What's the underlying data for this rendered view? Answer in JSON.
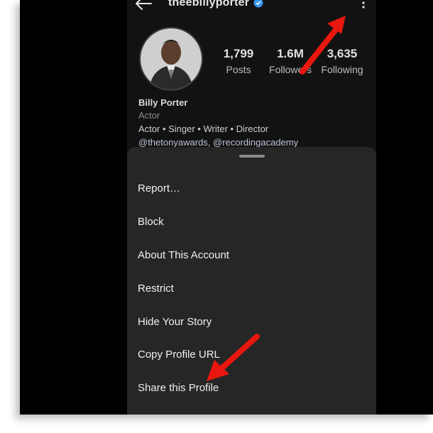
{
  "header": {
    "username": "theebillyporter",
    "icons": {
      "back": "arrow-left-icon",
      "verified": "verified-badge-icon",
      "more": "more-vertical-icon"
    }
  },
  "profile": {
    "stats": [
      {
        "value": "1,799",
        "label": "Posts"
      },
      {
        "value": "1.6M",
        "label": "Followers"
      },
      {
        "value": "3,635",
        "label": "Following"
      }
    ],
    "bio": {
      "name": "Billy Porter",
      "category": "Actor",
      "text": "Actor • Singer • Writer • Director",
      "mentions": "@thetonyawards, @recordingacademy"
    }
  },
  "menu": {
    "items": [
      {
        "label": "Report…"
      },
      {
        "label": "Block"
      },
      {
        "label": "About This Account"
      },
      {
        "label": "Restrict"
      },
      {
        "label": "Hide Your Story"
      },
      {
        "label": "Copy Profile URL"
      },
      {
        "label": "Share this Profile"
      }
    ]
  },
  "colors": {
    "background": "#121212",
    "sheet": "#262626",
    "text": "#f0f0f0",
    "verified": "#3897f0",
    "annotation_arrow": "#e8170f"
  }
}
